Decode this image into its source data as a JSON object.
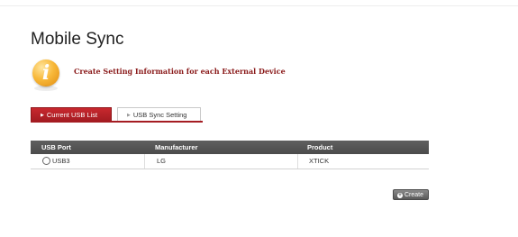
{
  "page": {
    "title": "Mobile Sync",
    "subtitle": "Create Setting Information for each External Device"
  },
  "tabs": [
    {
      "label": "Current USB List",
      "active": true
    },
    {
      "label": "USB Sync Setting",
      "active": false
    }
  ],
  "table": {
    "headers": [
      "USB Port",
      "Manufacturer",
      "Product"
    ],
    "rows": [
      {
        "port": "USB3",
        "manufacturer": "LG",
        "product": "XTICK"
      }
    ]
  },
  "actions": {
    "create_label": "Create"
  },
  "icons": {
    "info": "info-icon",
    "tab_arrow": "triangle-right-icon",
    "create": "plus-circle-icon"
  },
  "colors": {
    "accent": "#a51c22",
    "subtitle": "#8a1a1a",
    "header_bg": "#555555"
  }
}
